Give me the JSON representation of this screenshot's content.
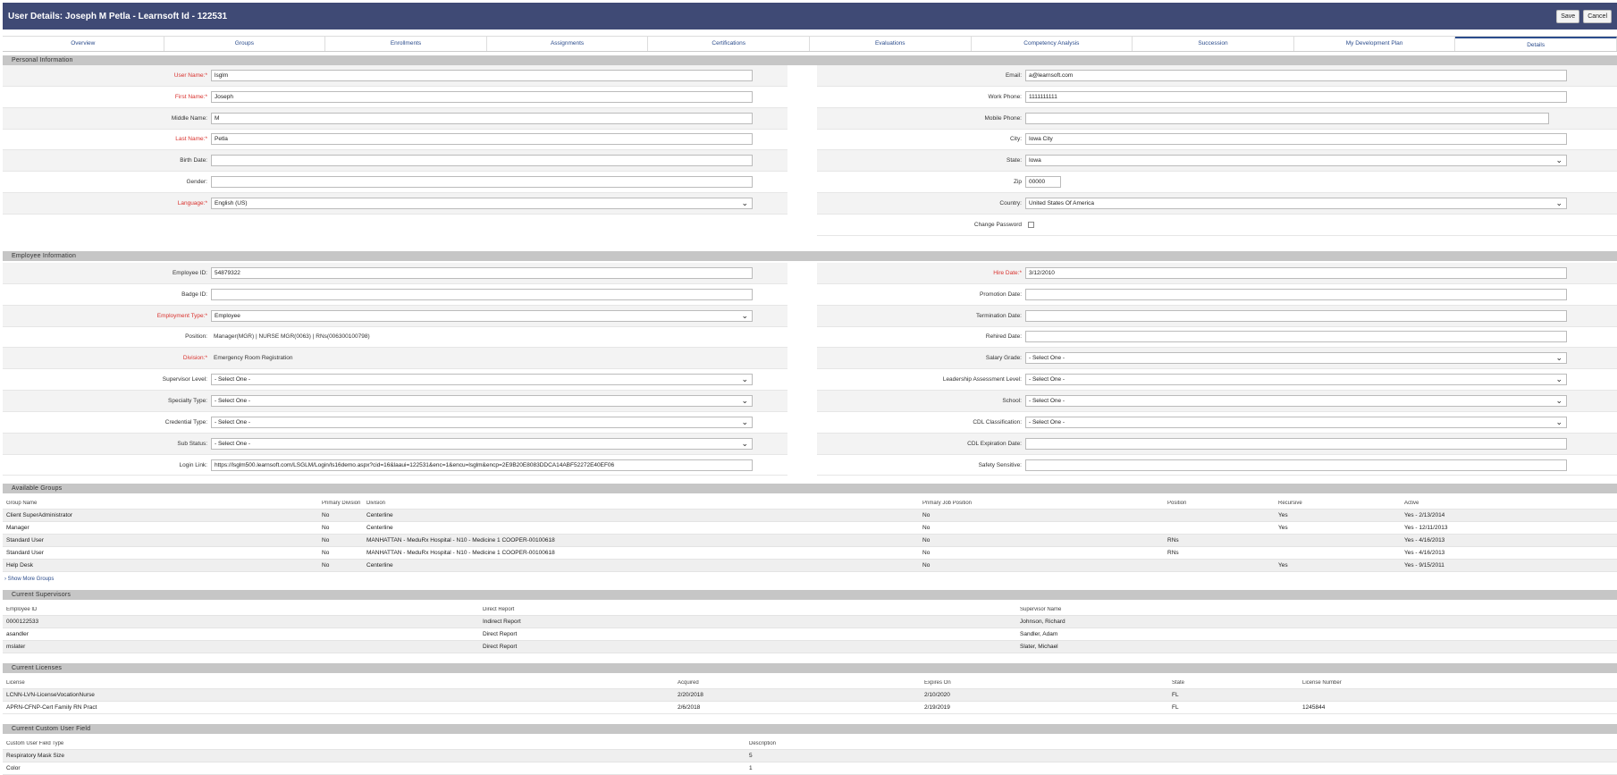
{
  "header": {
    "title": "User Details: Joseph M Petla - Learnsoft Id - 122531",
    "save": "Save",
    "cancel": "Cancel"
  },
  "tabs": [
    "Overview",
    "Groups",
    "Enrollments",
    "Assignments",
    "Certifications",
    "Evaluations",
    "Competency Analysis",
    "Succession",
    "My Development Plan",
    "Details"
  ],
  "personal": {
    "heading": "Personal Information",
    "left": [
      {
        "label": "User Name:*",
        "value": "lsglm",
        "req": true,
        "type": "input"
      },
      {
        "label": "First Name:*",
        "value": "Joseph",
        "req": true,
        "type": "input"
      },
      {
        "label": "Middle Name:",
        "value": "M",
        "type": "input"
      },
      {
        "label": "Last Name:*",
        "value": "Petla",
        "req": true,
        "type": "input"
      },
      {
        "label": "Birth Date:",
        "value": "",
        "type": "input"
      },
      {
        "label": "Gender:",
        "value": "",
        "type": "input"
      },
      {
        "label": "Language:*",
        "value": "English (US)",
        "req": true,
        "type": "select"
      }
    ],
    "right": [
      {
        "label": "Email:",
        "value": "a@learnsoft.com",
        "type": "input"
      },
      {
        "label": "Work Phone:",
        "value": "1111111111",
        "type": "input"
      },
      {
        "label": "Mobile Phone:",
        "value": "",
        "type": "input"
      },
      {
        "label": "City:",
        "value": "Iowa City",
        "type": "input"
      },
      {
        "label": "State:",
        "value": "Iowa",
        "type": "select"
      },
      {
        "label": "Zip",
        "value": "00000",
        "type": "input",
        "short": true
      },
      {
        "label": "Country:",
        "value": "United States Of America",
        "type": "select"
      },
      {
        "label": "Change Password",
        "value": "",
        "type": "check"
      }
    ]
  },
  "employee": {
    "heading": "Employee Information",
    "left": [
      {
        "label": "Employee ID:",
        "value": "54879322",
        "type": "input"
      },
      {
        "label": "Badge ID:",
        "value": "",
        "type": "input"
      },
      {
        "label": "Employment Type:*",
        "value": "Employee",
        "req": true,
        "type": "select"
      },
      {
        "label": "Position:",
        "value": "Manager(MGR) | NURSE MGR(0063) | RNs(006300100798)",
        "type": "text"
      },
      {
        "label": "Division:*",
        "value": "Emergency Room Registration",
        "req": true,
        "type": "text"
      },
      {
        "label": "Supervisor Level:",
        "value": "- Select One -",
        "type": "select"
      },
      {
        "label": "Specialty Type:",
        "value": "- Select One -",
        "type": "select"
      },
      {
        "label": "Credential Type:",
        "value": "- Select One -",
        "type": "select"
      },
      {
        "label": "Sub Status:",
        "value": "- Select One -",
        "type": "select"
      },
      {
        "label": "Login Link:",
        "value": "https://lsglm500.learnsoft.com/LSGLM/Login/ls16demo.aspx?cid=16&laaui=122531&enc=1&encu=lsglm&encp=2E9B20E8083DDCA14ABF52272E40EF06",
        "type": "input"
      }
    ],
    "right": [
      {
        "label": "Hire Date:*",
        "value": "3/12/2010",
        "req": true,
        "type": "input"
      },
      {
        "label": "Promotion Date:",
        "value": "",
        "type": "input"
      },
      {
        "label": "Termination Date:",
        "value": "",
        "type": "input"
      },
      {
        "label": "Rehired Date:",
        "value": "",
        "type": "input"
      },
      {
        "label": "Salary Grade:",
        "value": "- Select One -",
        "type": "select"
      },
      {
        "label": "Leadership Assessment Level:",
        "value": "- Select One -",
        "type": "select"
      },
      {
        "label": "School:",
        "value": "- Select One -",
        "type": "select"
      },
      {
        "label": "CDL Classification:",
        "value": "- Select One -",
        "type": "select"
      },
      {
        "label": "CDL Expiration Date:",
        "value": "",
        "type": "input"
      },
      {
        "label": "Safety Sensitive:",
        "value": "",
        "type": "input"
      }
    ]
  },
  "groups": {
    "heading": "Available Groups",
    "more": "› Show More Groups",
    "columns": [
      "Group Name",
      "Primary Division",
      "Division",
      "Primary Job Position",
      "Position",
      "Recursive",
      "Active"
    ],
    "rows": [
      [
        "Client SuperAdministrator",
        "No",
        "Centerline",
        "No",
        "",
        "Yes",
        "Yes - 2/13/2014"
      ],
      [
        "Manager",
        "No",
        "Centerline",
        "No",
        "",
        "Yes",
        "Yes - 12/11/2013"
      ],
      [
        "Standard User",
        "No",
        "MANHATTAN - MeduRx Hospital - N10 - Medicine 1 COOPER-00100618",
        "No",
        "RNs",
        "",
        "Yes - 4/16/2013"
      ],
      [
        "Standard User",
        "No",
        "MANHATTAN - MeduRx Hospital - N10 - Medicine 1 COOPER-00100618",
        "No",
        "RNs",
        "",
        "Yes - 4/16/2013"
      ],
      [
        "Help Desk",
        "No",
        "Centerline",
        "No",
        "",
        "Yes",
        "Yes - 9/15/2011"
      ]
    ]
  },
  "supervisors": {
    "heading": "Current Supervisors",
    "columns": [
      "Employee ID",
      "Direct Report",
      "Supervisor Name"
    ],
    "rows": [
      [
        "0000122533",
        "Indirect Report",
        "Johnson, Richard"
      ],
      [
        "asandler",
        "Direct Report",
        "Sandler, Adam"
      ],
      [
        "mslater",
        "Direct Report",
        "Slater, Michael"
      ]
    ]
  },
  "licenses": {
    "heading": "Current Licenses",
    "columns": [
      "License",
      "Acquired",
      "Expires On",
      "State",
      "License Number"
    ],
    "rows": [
      [
        "LCNN-LVN-LicenseVocationNurse",
        "2/20/2018",
        "2/10/2020",
        "FL",
        ""
      ],
      [
        "APRN-CFNP-Cert Family RN Pract",
        "2/6/2018",
        "2/19/2019",
        "FL",
        "1245844"
      ]
    ]
  },
  "custom": {
    "heading": "Current Custom User Field",
    "columns": [
      "Custom User Field Type",
      "Description"
    ],
    "rows": [
      [
        "Respiratory Mask Size",
        "5"
      ],
      [
        "Color",
        "1"
      ]
    ]
  }
}
